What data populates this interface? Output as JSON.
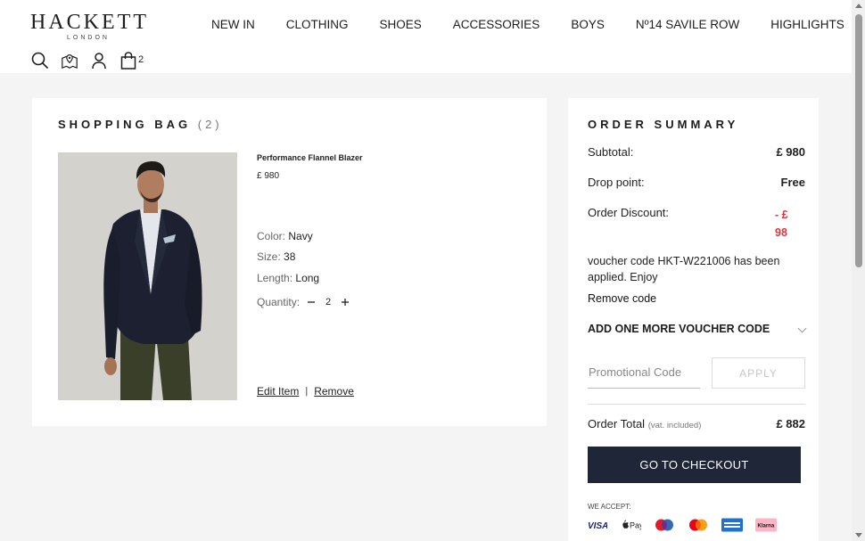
{
  "header": {
    "logo": "HACKETT",
    "logo_sub": "LONDON",
    "nav": [
      "NEW IN",
      "CLOTHING",
      "SHOES",
      "ACCESSORIES",
      "BOYS",
      "Nº14 SAVILE ROW",
      "HIGHLIGHTS"
    ],
    "bag_count": "2"
  },
  "bag": {
    "title": "SHOPPING BAG",
    "count": "(2)",
    "item": {
      "name": "Performance Flannel Blazer",
      "price": "£ 980",
      "color_label": "Color:",
      "color_value": "Navy",
      "size_label": "Size:",
      "size_value": "38",
      "length_label": "Length:",
      "length_value": "Long",
      "quantity_label": "Quantity:",
      "quantity_value": "2",
      "edit_label": "Edit Item",
      "separator": "|",
      "remove_label": "Remove"
    }
  },
  "summary": {
    "title": "ORDER SUMMARY",
    "subtotal_label": "Subtotal:",
    "subtotal_value": "£ 980",
    "drop_label": "Drop point:",
    "drop_value": "Free",
    "discount_label": "Order Discount:",
    "discount_value": "- £ 98",
    "voucher_message": "voucher code HKT-W221006 has been applied. Enjoy",
    "remove_code": "Remove code",
    "add_voucher": "ADD ONE MORE VOUCHER CODE",
    "promo_placeholder": "Promotional Code",
    "apply_label": "APPLY",
    "total_label": "Order Total",
    "total_vat": "(vat. included)",
    "total_value": "£ 882",
    "checkout_label": "GO TO CHECKOUT",
    "we_accept": "WE ACCEPT:",
    "payment_methods": [
      "VISA",
      "Pay",
      "Maestro",
      "Mastercard",
      "Amex",
      "Klarna"
    ],
    "payment_labels": {
      "visa": "VISA",
      "applepay": "Pay",
      "klarna": "Klarna"
    }
  },
  "colors": {
    "checkout_bg": "#1f2637",
    "discount": "#d9363e",
    "page_bg": "#f4f4f4"
  }
}
